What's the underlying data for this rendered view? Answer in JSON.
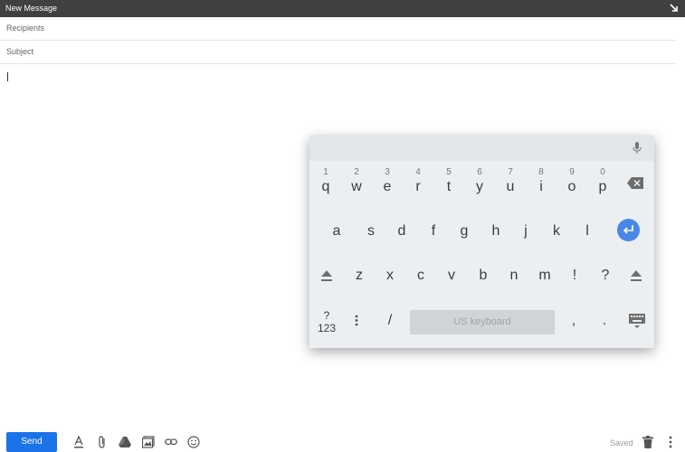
{
  "window": {
    "title": "New Message"
  },
  "compose": {
    "recipients_placeholder": "Recipients",
    "subject_placeholder": "Subject"
  },
  "keyboard": {
    "row1": [
      {
        "num": "1",
        "ch": "q"
      },
      {
        "num": "2",
        "ch": "w"
      },
      {
        "num": "3",
        "ch": "e"
      },
      {
        "num": "4",
        "ch": "r"
      },
      {
        "num": "5",
        "ch": "t"
      },
      {
        "num": "6",
        "ch": "y"
      },
      {
        "num": "7",
        "ch": "u"
      },
      {
        "num": "8",
        "ch": "i"
      },
      {
        "num": "9",
        "ch": "o"
      },
      {
        "num": "0",
        "ch": "p"
      }
    ],
    "row2": [
      "a",
      "s",
      "d",
      "f",
      "g",
      "h",
      "j",
      "k",
      "l"
    ],
    "row3": [
      "z",
      "x",
      "c",
      "v",
      "b",
      "n",
      "m",
      "!",
      "?"
    ],
    "symbols_top": "?",
    "symbols_bottom": "123",
    "slash": "/",
    "comma": ",",
    "period": ".",
    "spacebar_label": "US keyboard"
  },
  "toolbar": {
    "send_label": "Send",
    "status": "Saved"
  },
  "colors": {
    "accent": "#1a73e8",
    "titlebar": "#404040",
    "enter_key": "#4a86e8"
  }
}
